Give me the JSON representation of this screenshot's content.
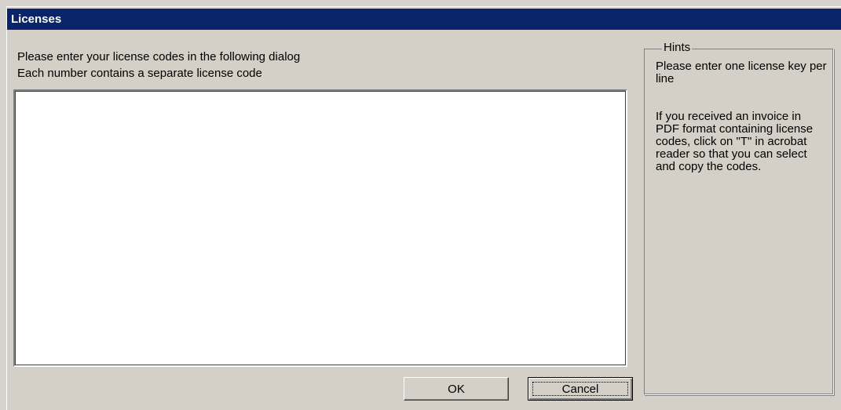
{
  "window": {
    "title": "Licenses"
  },
  "instructions": {
    "line1": "Please enter your license codes in the following dialog",
    "line2": "Each number contains a separate license code"
  },
  "license_input": {
    "value": "",
    "placeholder": ""
  },
  "hints": {
    "legend": "Hints",
    "paragraph1": "Please enter one license key per line",
    "paragraph2": "If you received an invoice in PDF format containing license codes, click on \"T\" in acrobat reader so that you can select and copy the codes."
  },
  "buttons": {
    "ok_label": "OK",
    "cancel_label": "Cancel"
  },
  "colors": {
    "title_bar": "#0a246a",
    "dialog_background": "#d4d0c8",
    "input_background": "#ffffff"
  }
}
